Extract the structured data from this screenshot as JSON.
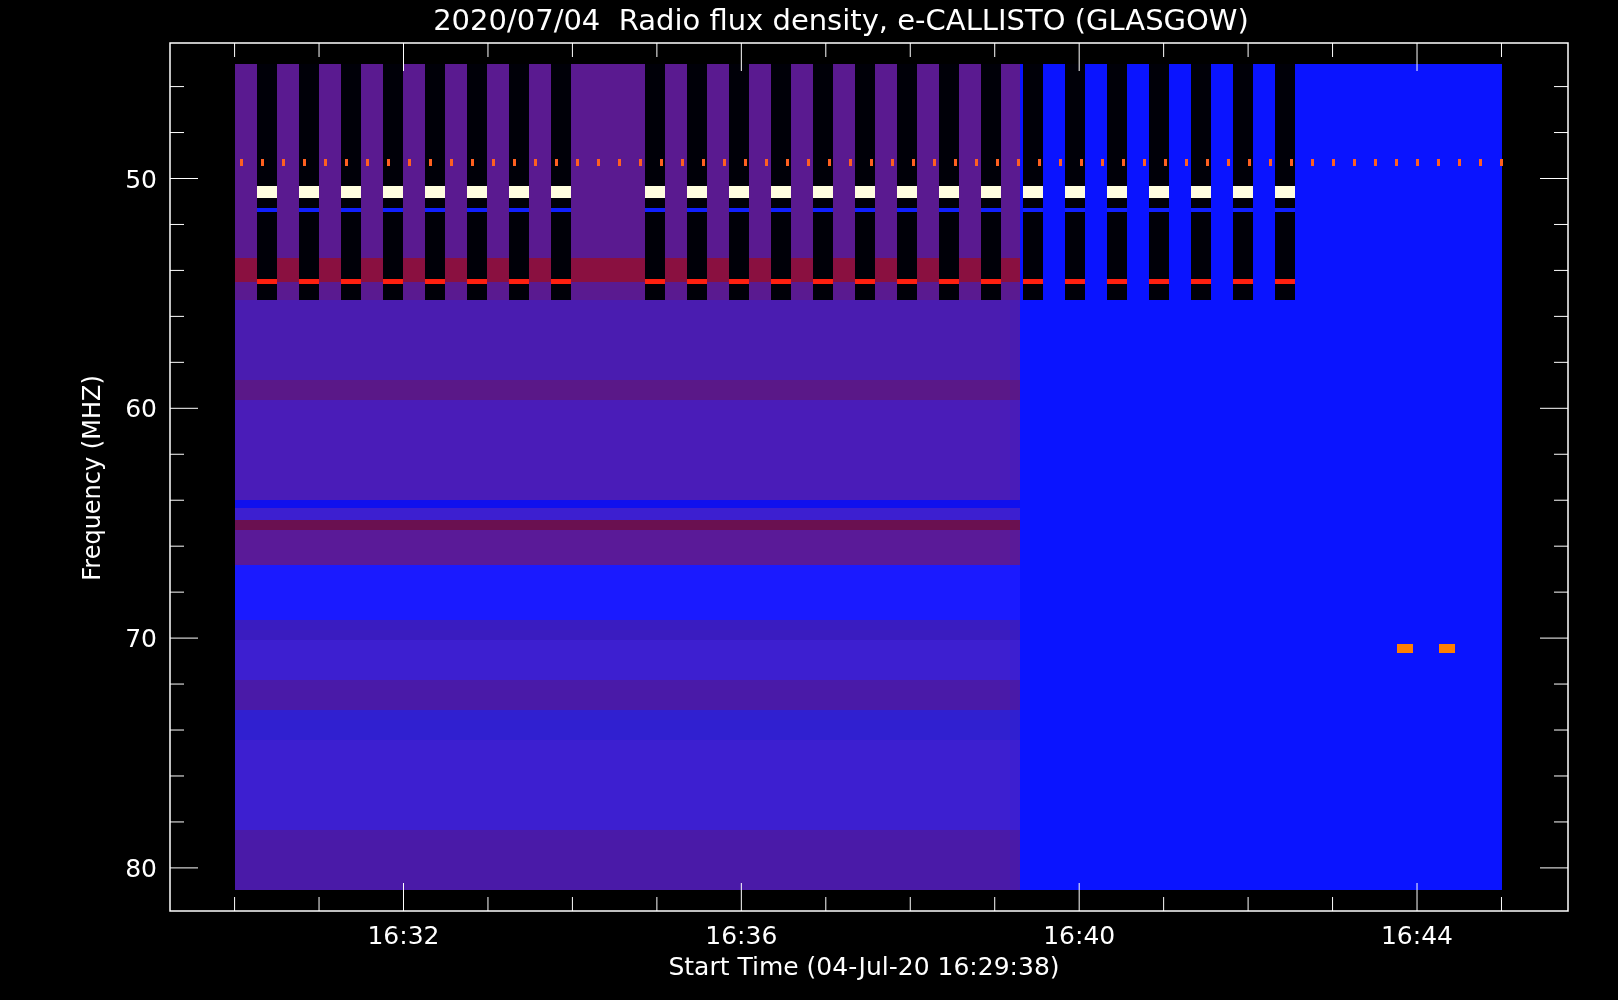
{
  "title": "2020/07/04  Radio flux density, e-CALLISTO (GLASGOW)",
  "plot": {
    "ylabel": "Frequency (MHZ)",
    "xlabel": "Start Time (04-Jul-20 16:29:38)",
    "yticks": [
      "50",
      "60",
      "70",
      "80"
    ],
    "xticks": [
      "16:32",
      "16:36",
      "16:40",
      "16:44"
    ]
  }
}
